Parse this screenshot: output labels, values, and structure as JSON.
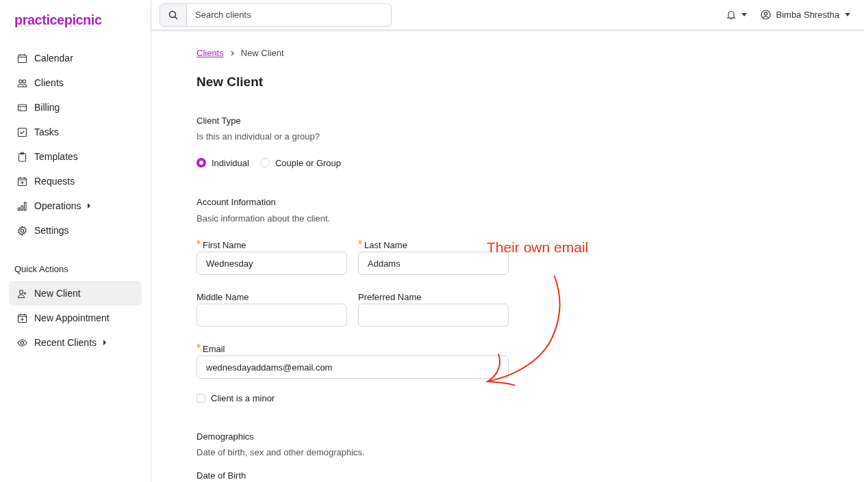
{
  "logo": "practicepicnic",
  "search": {
    "placeholder": "Search clients"
  },
  "user": {
    "name": "Bimba Shrestha"
  },
  "sidebar": {
    "items": [
      {
        "label": "Calendar",
        "submenu": false,
        "selected": false
      },
      {
        "label": "Clients",
        "submenu": false,
        "selected": false
      },
      {
        "label": "Billing",
        "submenu": false,
        "selected": false
      },
      {
        "label": "Tasks",
        "submenu": false,
        "selected": false
      },
      {
        "label": "Templates",
        "submenu": false,
        "selected": false
      },
      {
        "label": "Requests",
        "submenu": false,
        "selected": false
      },
      {
        "label": "Operations",
        "submenu": true,
        "selected": false
      },
      {
        "label": "Settings",
        "submenu": false,
        "selected": false
      }
    ],
    "quick_actions_title": "Quick Actions",
    "quick_actions": [
      {
        "label": "New Client",
        "submenu": false,
        "selected": true
      },
      {
        "label": "New Appointment",
        "submenu": false,
        "selected": false
      },
      {
        "label": "Recent Clients",
        "submenu": true,
        "selected": false
      }
    ]
  },
  "breadcrumb": [
    {
      "label": "Clients",
      "link": true
    },
    {
      "label": "New Client",
      "link": false
    }
  ],
  "page_title": "New Client",
  "client_type": {
    "title": "Client Type",
    "subtitle": "Is this an individual or a group?",
    "options": [
      {
        "label": "Individual",
        "selected": true
      },
      {
        "label": "Couple or Group",
        "selected": false
      }
    ]
  },
  "account": {
    "title": "Account Information",
    "subtitle": "Basic information about the client.",
    "fields": [
      {
        "label": "First Name",
        "required": true,
        "value": "Wednesday",
        "wide": false
      },
      {
        "label": "Last Name",
        "required": true,
        "value": "Addams",
        "wide": false
      },
      {
        "label": "Middle Name",
        "required": false,
        "wide": false
      },
      {
        "label": "Preferred Name",
        "required": false,
        "wide": false
      },
      {
        "label": "Email",
        "required": true,
        "value": "wednesdayaddams@email.com",
        "wide": true
      }
    ],
    "minor": {
      "label": "Client is a minor",
      "checked": false
    }
  },
  "demographics": {
    "title": "Demographics",
    "subtitle": "Date of birth, sex and other demographics.",
    "next_label": "Date of Birth"
  },
  "annotation": {
    "text": "Their own email"
  }
}
